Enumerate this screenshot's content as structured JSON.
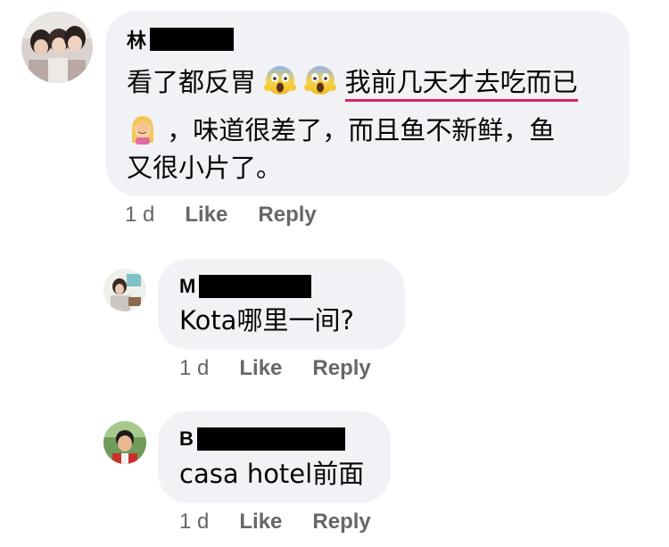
{
  "comments": [
    {
      "author_initial": "林",
      "lines": [
        "看了都反胃",
        "我前几天才去吃而已",
        "，味道很差了，而且鱼不新鲜，鱼",
        "又很小片了。"
      ],
      "time": "1 d",
      "like_label": "Like",
      "reply_label": "Reply"
    },
    {
      "author_initial": "M",
      "text": "Kota哪里一间?",
      "time": "1 d",
      "like_label": "Like",
      "reply_label": "Reply"
    },
    {
      "author_initial": "B",
      "text": "casa hotel前面",
      "time": "1 d",
      "like_label": "Like",
      "reply_label": "Reply"
    }
  ],
  "icons": {
    "scream_emoji": "face-screaming-in-fear-icon",
    "facepalm_emoji": "woman-facepalming-icon"
  },
  "colors": {
    "bubble": "#f0f2f5",
    "underline": "#e0245e",
    "meta_text": "#65676b"
  }
}
